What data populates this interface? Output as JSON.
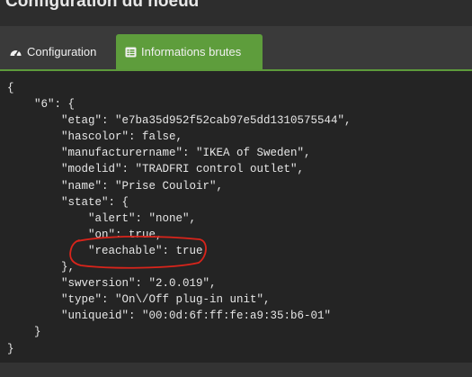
{
  "header": {
    "title": "Configuration du noeud"
  },
  "tabs": [
    {
      "label": "Configuration",
      "icon": "dashboard-icon",
      "active": false
    },
    {
      "label": "Informations brutes",
      "icon": "list-icon",
      "active": true
    }
  ],
  "code_lines": [
    "{",
    "    \"6\": {",
    "        \"etag\": \"e7ba35d952f52cab97e5dd1310575544\",",
    "        \"hascolor\": false,",
    "        \"manufacturername\": \"IKEA of Sweden\",",
    "        \"modelid\": \"TRADFRI control outlet\",",
    "        \"name\": \"Prise Couloir\",",
    "        \"state\": {",
    "            \"alert\": \"none\",",
    "            \"on\": true,",
    "            \"reachable\": true",
    "        },",
    "        \"swversion\": \"2.0.019\",",
    "        \"type\": \"On\\/Off plug-in unit\",",
    "        \"uniqueid\": \"00:0d:6f:ff:fe:a9:35:b6-01\"",
    "    }",
    "}"
  ],
  "colors": {
    "active_tab": "#5e9d3c",
    "annotation": "#d9241b",
    "background": "#242424"
  }
}
